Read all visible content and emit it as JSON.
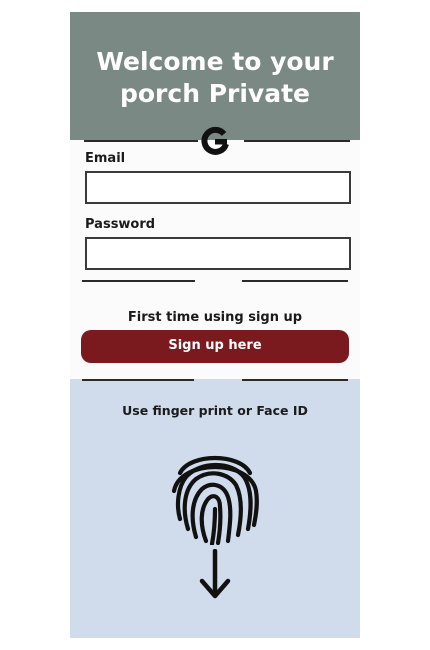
{
  "header": {
    "title": "Welcome to your porch Private"
  },
  "icons": {
    "google": "google-icon",
    "fingerprint": "fingerprint-icon",
    "arrow": "arrow-down-icon"
  },
  "form": {
    "email_label": "Email",
    "email_value": "",
    "password_label": "Password",
    "password_value": ""
  },
  "signup": {
    "hint": "First time using sign up",
    "button_label": "Sign up here"
  },
  "biometric": {
    "text": "Use finger print or Face ID"
  },
  "colors": {
    "header_bg": "#7b8985",
    "button_bg": "#7a1a1f",
    "biometric_bg": "#d0dceb"
  }
}
